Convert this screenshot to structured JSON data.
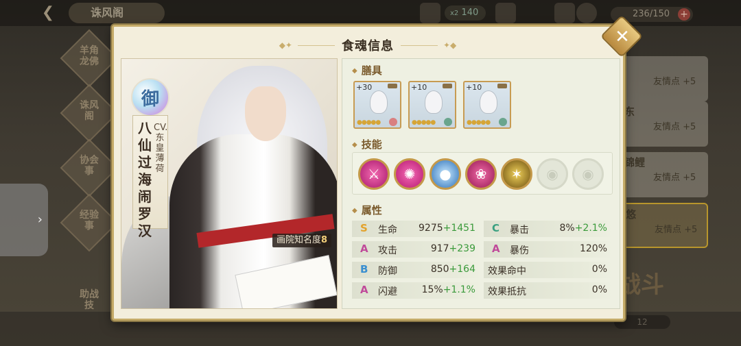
{
  "background": {
    "title": "诛风阁",
    "resource_text": "140",
    "resource_badge": "x2",
    "stamina": "236/150",
    "left_nav": [
      "羊角\n龙佛",
      "诛风\n阁",
      "协会\n事",
      "经验\n事",
      "助战\n技"
    ],
    "right_cards": [
      {
        "name": "",
        "friendship": "友情点 +5"
      },
      {
        "name": "东",
        "friendship": "友情点 +5"
      },
      {
        "name": "锦鲤",
        "friendship": "友情点 +5"
      },
      {
        "name": "悠",
        "friendship": "友情点 +5"
      }
    ],
    "battle_label": "战斗",
    "battle_count": "12"
  },
  "modal": {
    "title": "食魂信息",
    "close_icon": "close-icon"
  },
  "portrait": {
    "rank_glyph": "御",
    "name": "八仙过海闹罗汉",
    "cv": "CV. 东皇薄荷",
    "fame_label": "画院知名度",
    "fame_value": "8"
  },
  "sections": {
    "equipment": "膳具",
    "skills": "技能",
    "attributes": "属性"
  },
  "equipment": [
    {
      "level": "+30",
      "stars": "●●●●●"
    },
    {
      "level": "+10",
      "stars": "●●●●●"
    },
    {
      "level": "+10",
      "stars": "●●●●●"
    }
  ],
  "skills": [
    {
      "icon": "dagger-skill-icon",
      "color": "#c2278a",
      "locked": false
    },
    {
      "icon": "swirl-skill-icon",
      "color": "#d0247e",
      "locked": false
    },
    {
      "icon": "orb-skill-icon",
      "color": "#2a6fb8",
      "locked": false
    },
    {
      "icon": "flame-skill-icon",
      "color": "#b0205e",
      "locked": false
    },
    {
      "icon": "claw-skill-icon",
      "color": "#8a6a1a",
      "locked": false
    },
    {
      "icon": "eye-locked-icon",
      "color": "#e3e6d8",
      "locked": true
    },
    {
      "icon": "eye-locked-icon",
      "color": "#e3e6d8",
      "locked": true
    }
  ],
  "attributes": [
    {
      "left": {
        "grade": "S",
        "name": "生命",
        "value": "9275",
        "bonus": "+1451"
      },
      "right": {
        "grade": "C",
        "name": "暴击",
        "value": "8%",
        "bonus": "+2.1%"
      }
    },
    {
      "left": {
        "grade": "A",
        "name": "攻击",
        "value": "917",
        "bonus": "+239"
      },
      "right": {
        "grade": "A",
        "name": "暴伤",
        "value": "120%",
        "bonus": ""
      }
    },
    {
      "left": {
        "grade": "B",
        "name": "防御",
        "value": "850",
        "bonus": "+164"
      },
      "right": {
        "grade": "",
        "name": "效果命中",
        "value": "0%",
        "bonus": ""
      }
    },
    {
      "left": {
        "grade": "A",
        "name": "闪避",
        "value": "15%",
        "bonus": "+1.1%"
      },
      "right": {
        "grade": "",
        "name": "效果抵抗",
        "value": "0%",
        "bonus": ""
      }
    }
  ]
}
